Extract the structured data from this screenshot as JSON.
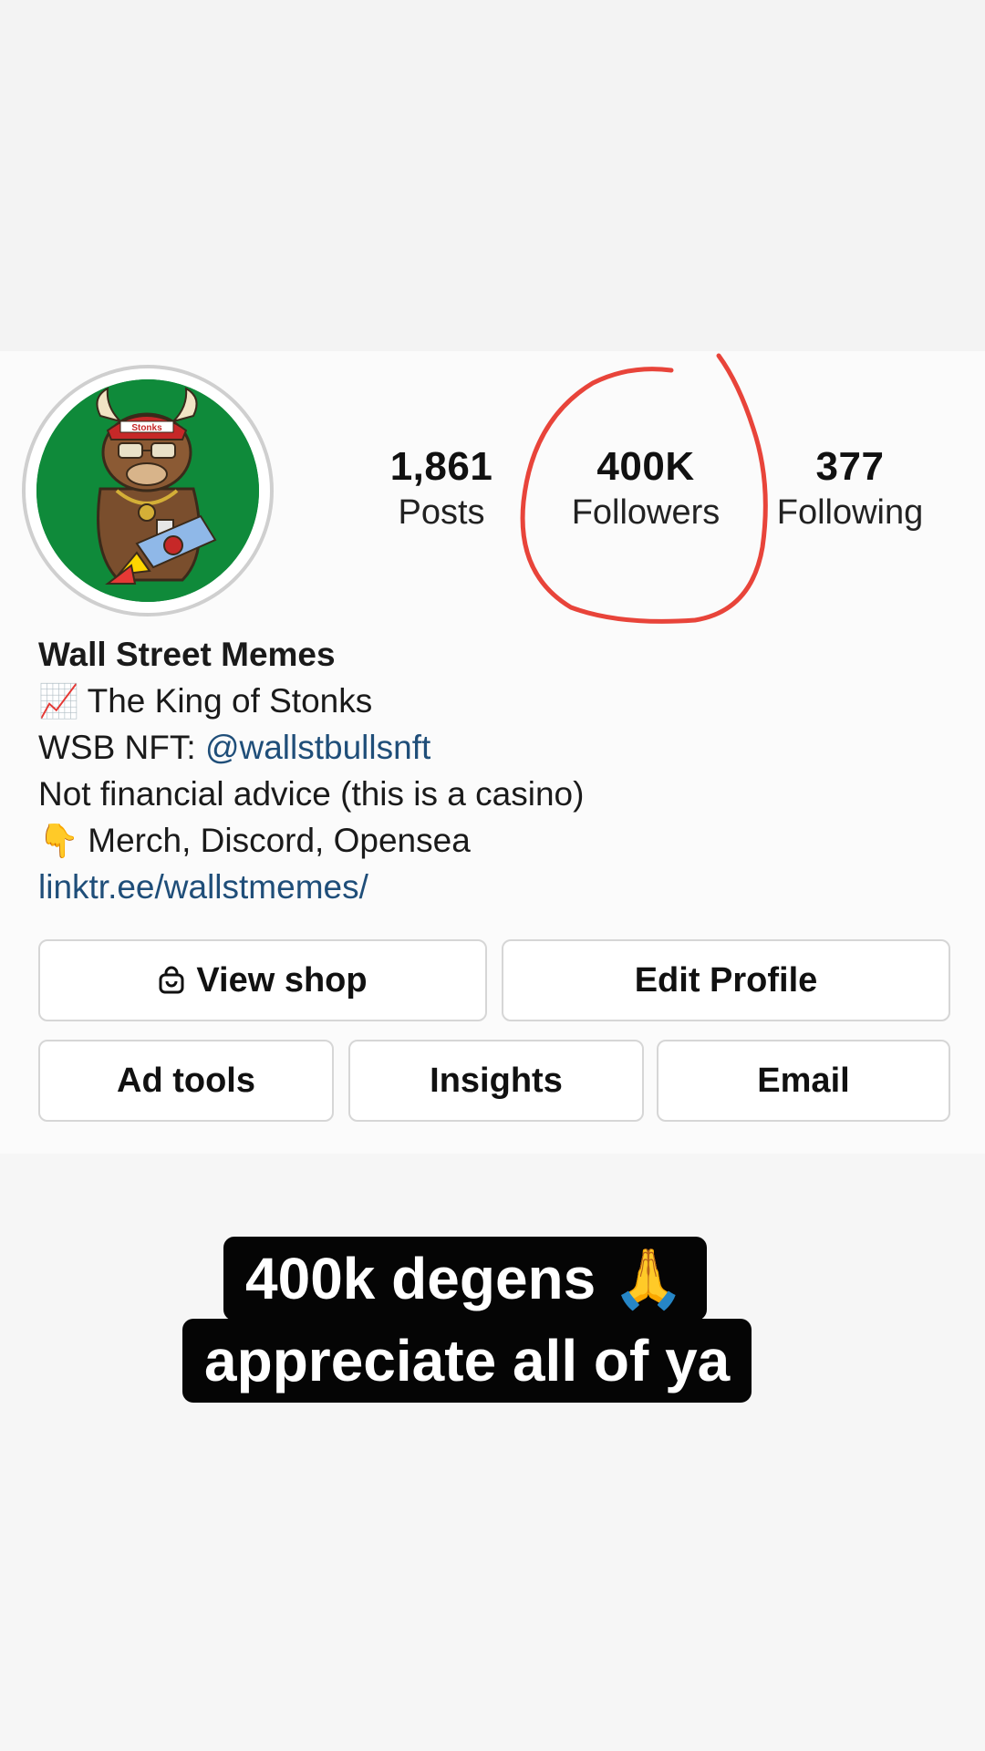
{
  "profile": {
    "name": "Wall Street Memes",
    "avatar_label": "Stonks",
    "stats": [
      {
        "value": "1,861",
        "label": "Posts"
      },
      {
        "value": "400K",
        "label": "Followers"
      },
      {
        "value": "377",
        "label": "Following"
      }
    ],
    "bio": {
      "line1_icon": "📈",
      "line1_text": "The King of Stonks",
      "line2_prefix": "WSB NFT: ",
      "line2_mention": "@wallstbullsnft",
      "line3_text": "Not financial advice (this is a casino)",
      "line4_icon": "👇",
      "line4_text": "Merch, Discord, Opensea",
      "link": "linktr.ee/wallstmemes/"
    }
  },
  "buttons": {
    "view_shop": "View shop",
    "edit_profile": "Edit Profile",
    "ad_tools": "Ad tools",
    "insights": "Insights",
    "email": "Email"
  },
  "caption": {
    "line1": "400k degens 🙏",
    "line2": "appreciate all of ya"
  },
  "colors": {
    "annotation_circle": "#e8443a",
    "link": "#1f4e79",
    "avatar_bg": "#0f8a3a"
  },
  "icons": {
    "shop": "shopping-bag-icon"
  }
}
